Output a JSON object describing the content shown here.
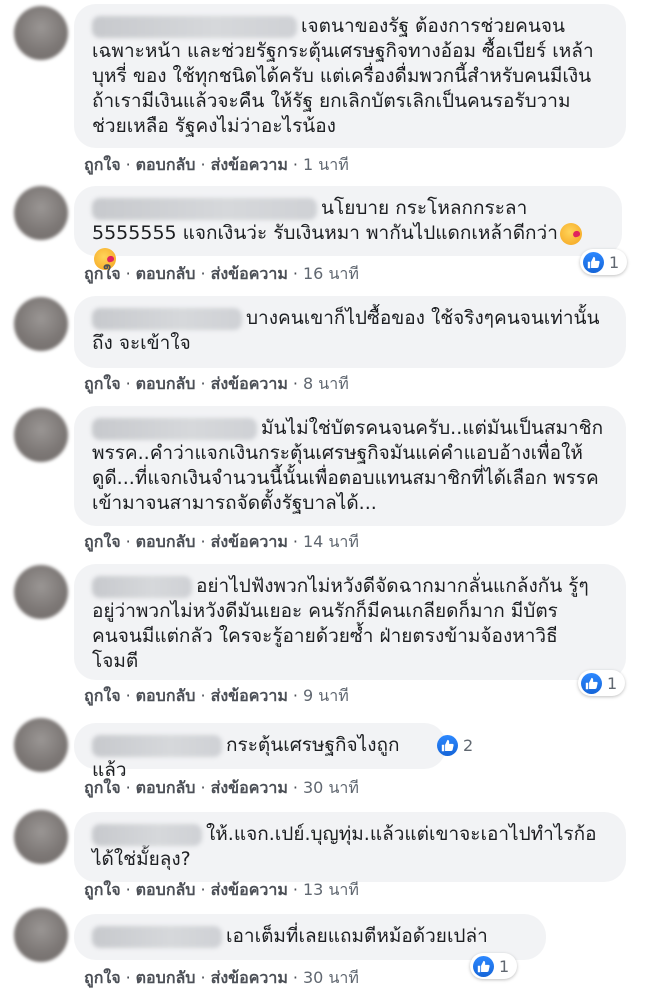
{
  "actions": {
    "like": "ถูกใจ",
    "reply": "ตอบกลับ",
    "message": "ส่งข้อความ",
    "separator": "·"
  },
  "comments": [
    {
      "text": "เจตนาของรัฐ ต้องการช่วยคนจน เฉพาะหน้า และช่วยรัฐกระตุ้นเศรษฐกิจทางอ้อม ซื้อเบียร์ เหล้า บุหรี่ ของ ใช้ทุกชนิดได้ครับ แต่เครื่องดื่มพวกนี้สำหรับคนมีเงิน ถ้าเรามีเงินแล้วจะคืน ให้รัฐ ยกเลิกบัตรเลิกเป็นคนรอรับวาม ช่วยเหลือ รัฐคงไม่ว่าอะไรน้อง",
      "time": "1 นาที"
    },
    {
      "text": "นโยบาย กระโหลกกระลา 5555555 แจกเงินว่ะ รับเงินหมา พากันไปแดกเหล้าดีกว่า",
      "time": "16 นาที",
      "reactions": "1",
      "emoji": "face-blowing-kiss-emoji"
    },
    {
      "text": "บางคนเขาก็ไปซื้อของ ใช้จริงๆคนจนเท่านั้นถึง จะเข้าใจ",
      "time": "8 นาที"
    },
    {
      "text": "มันไม่ใช่บัตรคนจนครับ..แต่มันเป็นสมาชิก พรรค..คำว่าแจกเงินกระตุ้นเศรษฐกิจมันแค่คำแอบอ้างเพื่อให้ ดูดี...ที่แจกเงินจำนวนนี้นั้นเพื่อตอบแทนสมาชิกที่ได้เลือก พรรคเข้ามาจนสามารถจัดตั้งรัฐบาลได้...",
      "time": "14 นาที"
    },
    {
      "text": "อย่าไปฟังพวกไม่หวังดีจัดฉากมากลั่นแกล้งกัน รู้ๆอยู่ว่าพวกไม่หวังดีมันเยอะ คนรักก็มีคนเกลียดก็มาก มีบัตร คนจนมีแต่กลัว ใครจะรู้อายด้วยซ้ำ ฝ่ายตรงข้ามจ้องหาวิธี โจมตี",
      "time": "9 นาที",
      "reactions": "1"
    },
    {
      "text": "กระตุ้นเศรษฐกิจไงถูกแล้ว",
      "time": "30 นาที",
      "reactions": "2"
    },
    {
      "text": "ให้.แจก.เปย์.บุญทุ่ม.แล้วแต่เขาจะเอาไปทำไรก้อ ได้ใช่มั้ยลุง?",
      "time": "13 นาที"
    },
    {
      "text": "เอาเต็มที่เลยแถมตีหม้อด้วยเปล่า",
      "time": "30 นาที",
      "reactions": "1"
    }
  ]
}
